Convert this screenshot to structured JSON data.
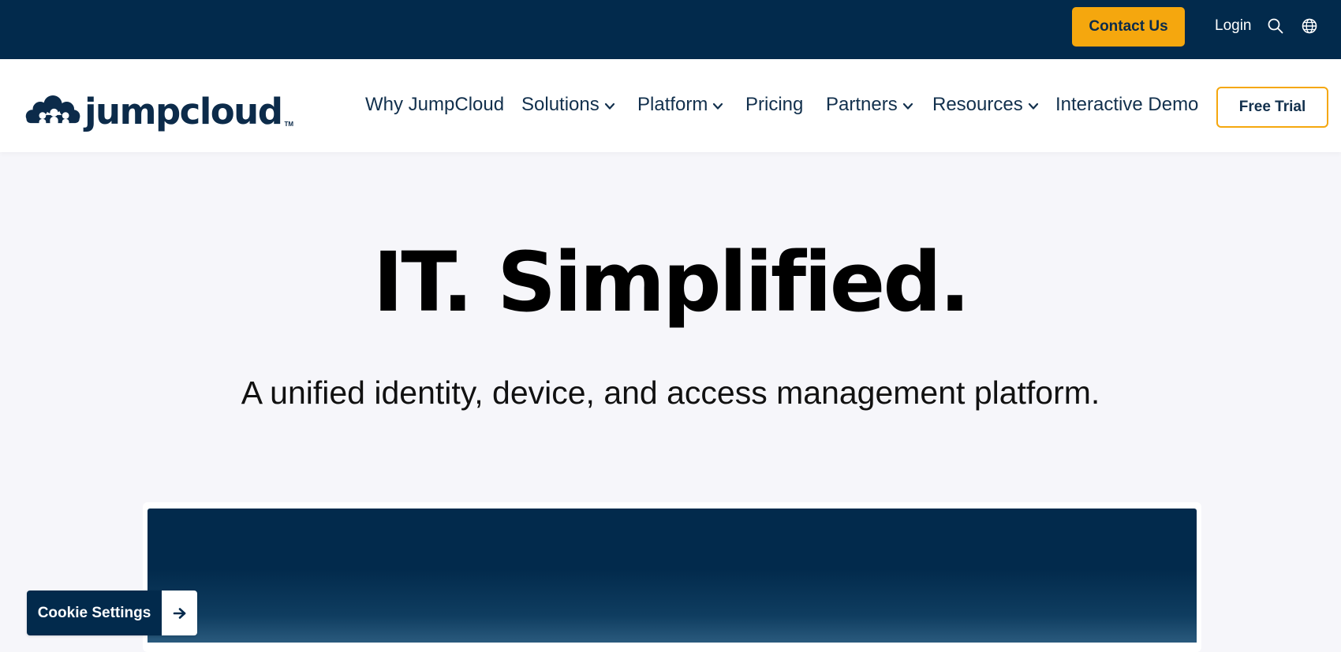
{
  "topbar": {
    "contact_label": "Contact Us",
    "login_label": "Login",
    "search_icon": "search-icon",
    "language_icon": "globe-icon"
  },
  "nav": {
    "logo_text": "jumpcloud",
    "logo_tm": "TM",
    "items": [
      {
        "label": "Why JumpCloud",
        "dropdown": false
      },
      {
        "label": "Solutions",
        "dropdown": true
      },
      {
        "label": "Platform",
        "dropdown": true
      },
      {
        "label": "Pricing",
        "dropdown": false
      },
      {
        "label": "Partners",
        "dropdown": true
      },
      {
        "label": "Resources",
        "dropdown": true
      },
      {
        "label": "Interactive Demo",
        "dropdown": false
      }
    ],
    "free_trial_label": "Free Trial"
  },
  "hero": {
    "title": "IT. Simplified.",
    "subtitle": "A unified identity, device, and access management platform."
  },
  "cookie": {
    "label": "Cookie Settings",
    "arrow_icon": "arrow-right-icon"
  },
  "colors": {
    "navy": "#022a4c",
    "accent": "#f5a70e",
    "text_dark": "#12304d",
    "page_bg": "#f6f6fa"
  }
}
